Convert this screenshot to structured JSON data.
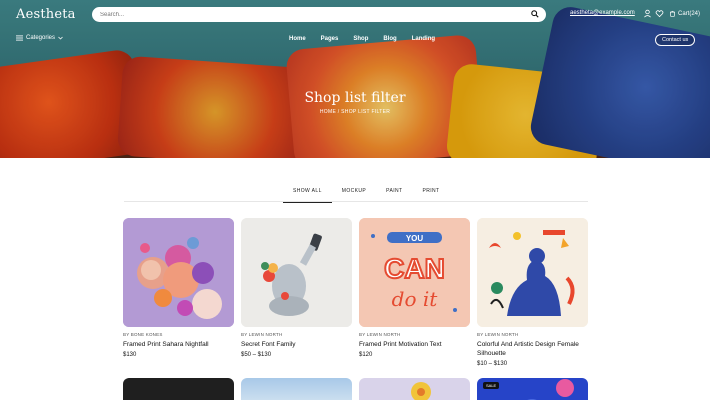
{
  "header": {
    "logo": "Aestheta",
    "search_placeholder": "Search...",
    "email": "aestheta@example.com",
    "cart_label": "Cart(24)"
  },
  "nav": {
    "categories_label": "Categories",
    "items": [
      "Home",
      "Pages",
      "Shop",
      "Blog",
      "Landing"
    ],
    "contact_label": "Contact us"
  },
  "hero": {
    "title": "Shop list filter",
    "breadcrumb": "HOME / SHOP LIST FILTER"
  },
  "filters": {
    "tabs": [
      "SHOW ALL",
      "MOCKUP",
      "PAINT",
      "PRINT"
    ],
    "active": "SHOW ALL"
  },
  "products": [
    {
      "author": "BY BONE KONES",
      "name": "Framed Print Sahara Nightfall",
      "price": "$130"
    },
    {
      "author": "BY LEWIN NORTH",
      "name": "Secret Font Family",
      "price": "$50 – $130"
    },
    {
      "author": "BY LEWIN NORTH",
      "name": "Framed Print Motivation Text",
      "price": "$120"
    },
    {
      "author": "BY LEWIN NORTH",
      "name": "Colorful And Artistic Design Female Silhouette",
      "price": "$10 – $130"
    }
  ],
  "badges": {
    "sale": "SALE"
  },
  "artwork": {
    "can_do_it_top": "YOU",
    "can_do_it_mid": "CAN",
    "can_do_it_bottom": "do it"
  },
  "colors": {
    "hero_teal": "#3c7d80",
    "accent_orange": "#e8612a",
    "text_dark": "#111111"
  }
}
